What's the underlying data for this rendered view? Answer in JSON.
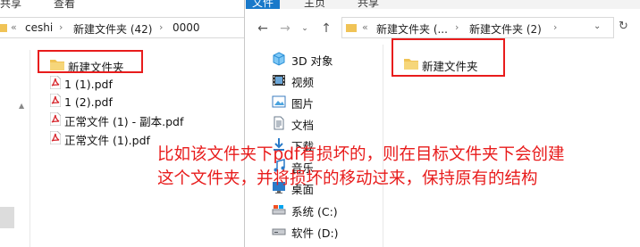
{
  "left_window": {
    "ribbon_tabs": [
      "共享",
      "查看"
    ],
    "breadcrumb": [
      "ceshi",
      "新建文件夹 (42)",
      "0000"
    ],
    "breadcrumb_prefix": "«",
    "items": [
      {
        "name": "新建文件夹",
        "type": "folder"
      },
      {
        "name": "1 (1).pdf",
        "type": "pdf"
      },
      {
        "name": "1 (2).pdf",
        "type": "pdf"
      },
      {
        "name": "正常文件 (1) - 副本.pdf",
        "type": "pdf"
      },
      {
        "name": "正常文件 (1).pdf",
        "type": "pdf"
      }
    ]
  },
  "right_window": {
    "ribbon_tabs": [
      "文件",
      "主页",
      "共享"
    ],
    "breadcrumb": [
      "新建文件夹 (...",
      "新建文件夹 (2)"
    ],
    "breadcrumb_prefix": "«",
    "nav_items": [
      {
        "label": "3D 对象",
        "icon": "3d-objects-icon"
      },
      {
        "label": "视频",
        "icon": "video-icon"
      },
      {
        "label": "图片",
        "icon": "pictures-icon"
      },
      {
        "label": "文档",
        "icon": "documents-icon"
      },
      {
        "label": "下载",
        "icon": "downloads-icon"
      },
      {
        "label": "音乐",
        "icon": "music-icon"
      },
      {
        "label": "桌面",
        "icon": "desktop-icon"
      },
      {
        "label": "系统 (C:)",
        "icon": "drive-c-icon"
      },
      {
        "label": "软件 (D:)",
        "icon": "drive-d-icon"
      }
    ],
    "items": [
      {
        "name": "新建文件夹",
        "type": "folder"
      }
    ]
  },
  "annotation": {
    "line1": "比如该文件夹下pdf有损坏的，则在目标文件夹下会创建",
    "line2": "这个文件夹，并将损坏的移动过来，保持原有的结构"
  },
  "colors": {
    "highlight": "#e81c1c",
    "accent": "#1979ca",
    "folder": "#f0c356",
    "pdf": "#d7262d"
  }
}
